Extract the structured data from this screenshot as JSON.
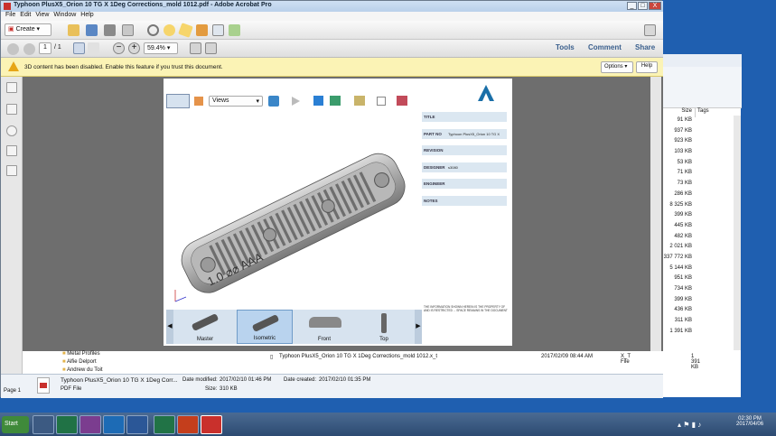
{
  "window": {
    "title": "Typhoon PlusX5_Orion 10  TG X 1Deg Corrections_mold 1012.pdf - Adobe Acrobat Pro",
    "min": "_",
    "max": "□",
    "close": "X"
  },
  "menu": [
    "File",
    "Edit",
    "View",
    "Window",
    "Help"
  ],
  "toolbar": {
    "create": "Create",
    "page_current": "1",
    "page_total": "/ 1",
    "zoom": "59.4%",
    "tools": "Tools",
    "comment": "Comment",
    "share": "Share"
  },
  "warning": {
    "text": "3D content has been disabled. Enable this feature if you trust this document.",
    "options": "Options",
    "help": "Help"
  },
  "viewer": {
    "views": "Views",
    "part_label": "1.0  ⌀⌀  AAA"
  },
  "props": [
    {
      "label": "TITLE",
      "value": ""
    },
    {
      "label": "PART NO",
      "value": "Typhoon PlusX5_Orion 10  TG X"
    },
    {
      "label": "REVISION",
      "value": ""
    },
    {
      "label": "DESIGNER",
      "value": "s3080"
    },
    {
      "label": "ENGINEER",
      "value": ""
    },
    {
      "label": "NOTES",
      "value": ""
    }
  ],
  "disclaimer": "THE INFORMATION SHOWN HEREIN IS THE PROPERTY OF AND IS RESTRICTED ... SPACE REMAINS IN THE DOCUMENT",
  "thumbs": [
    "Master",
    "Isometric",
    "Front",
    "Top"
  ],
  "explorer": {
    "col_size": "Size",
    "col_tags": "Tags",
    "sizes": [
      "91 KB",
      "937 KB",
      "923 KB",
      "103 KB",
      "53 KB",
      "71 KB",
      "73 KB",
      "286 KB",
      "8 325 KB",
      "399 KB",
      "445 KB",
      "482 KB",
      "2 021 KB",
      "337 772 KB",
      "5 144 KB",
      "951 KB",
      "734 KB",
      "399 KB",
      "436 KB",
      "311 KB",
      "1 391 KB"
    ],
    "folders": [
      "Metal Profiles",
      "Alfie Delport",
      "Andrew du Toit"
    ],
    "file_row": {
      "name": "Typhoon PlusX5_Orion 10  TG X 1Deg Corrections_mold 1012.x_t",
      "date": "2017/02/09 08:44 AM",
      "type": "X_T File",
      "size": "1 391 KB"
    }
  },
  "status": {
    "page": "Page 1",
    "name": "Typhoon PlusX5_Orion 10   TG X 1Deg Corr...",
    "modified_label": "Date modified:",
    "modified": "2017/02/10 01:46 PM",
    "created_label": "Date created:",
    "created": "2017/02/10 01:35 PM",
    "type": "PDF File",
    "size_label": "Size:",
    "size": "310 KB"
  },
  "taskbar": {
    "start": "Start",
    "time": "02:30 PM",
    "date": "2017/04/06"
  },
  "colors": {
    "accent": "#1f5fb0",
    "warn": "#fbf3b5",
    "doc_bg": "#6e6e6e"
  }
}
